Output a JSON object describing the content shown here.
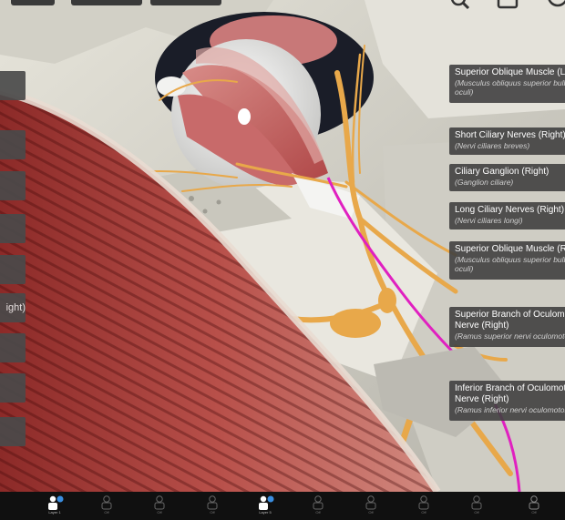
{
  "labels": [
    {
      "name": "Superior Oblique Muscle (Left)",
      "latin": [
        "(Musculus obliquus superior bulbi",
        "oculi)"
      ]
    },
    {
      "name": "Short Ciliary Nerves (Right)",
      "latin": [
        "(Nervi ciliares breves)"
      ]
    },
    {
      "name": "Ciliary Ganglion (Right)",
      "latin": [
        "(Ganglion ciliare)"
      ]
    },
    {
      "name": "Long Ciliary Nerves (Right)",
      "latin": [
        "(Nervi ciliares longi)"
      ]
    },
    {
      "name": "Superior Oblique Muscle (Right)",
      "latin": [
        "(Musculus obliquus superior bulbi",
        "oculi)"
      ]
    },
    {
      "name": [
        "Superior Branch of Oculomotor",
        "Nerve (Right)"
      ],
      "latin": [
        "(Ramus superior nervi oculomotorii)"
      ]
    },
    {
      "name": [
        "Inferior Branch of Oculomotor",
        "Nerve (Right)"
      ],
      "latin": [
        "(Ramus inferior nervi oculomotorii)"
      ]
    }
  ],
  "left_panel": {
    "partial_text": "ight)"
  },
  "top_toolbar": {
    "icons": [
      "search-icon",
      "layers-icon",
      "settings-icon"
    ]
  },
  "bottom_bar": {
    "items": [
      {
        "icon": "person-icon",
        "caption": "Layer 1",
        "active": true
      },
      {
        "icon": "person-icon",
        "caption": "Off",
        "active": false
      },
      {
        "icon": "person-icon",
        "caption": "Off",
        "active": false
      },
      {
        "icon": "person-icon",
        "caption": "Off",
        "active": false
      },
      {
        "icon": "person-icon",
        "caption": "Layer 5",
        "active": true
      },
      {
        "icon": "person-icon",
        "caption": "Off",
        "active": false
      },
      {
        "icon": "person-icon",
        "caption": "Off",
        "active": false
      },
      {
        "icon": "person-icon",
        "caption": "Off",
        "active": false
      },
      {
        "icon": "person-icon",
        "caption": "Off",
        "active": false
      },
      {
        "icon": "person-icon",
        "caption": "Off",
        "active": false
      }
    ]
  },
  "colors": {
    "label_bg": "#404040",
    "nerve": "#e8a84a",
    "artery": "#e020c0",
    "muscle": "#c85a5a",
    "bone": "#d8d6cc",
    "toolbar_bg": "#101010",
    "badge": "#3a8de0"
  }
}
